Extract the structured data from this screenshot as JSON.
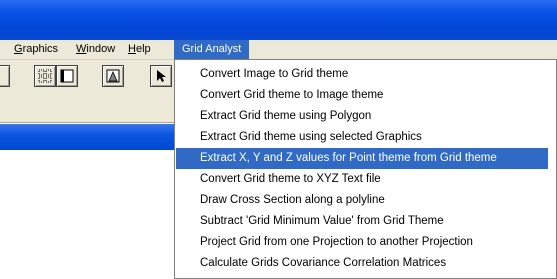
{
  "menubar": {
    "items": [
      {
        "label": "Graphics",
        "mnemonic": "G"
      },
      {
        "label": "Window",
        "mnemonic": "W"
      },
      {
        "label": "Help",
        "mnemonic": "H"
      },
      {
        "label": "Grid Analyst",
        "active": true
      }
    ]
  },
  "toolbar": {
    "buttons": [
      "partial-button-icon",
      "select-grid-icon",
      "layout-icon",
      "histogram-icon",
      "pointer-icon"
    ]
  },
  "grid_analyst_menu": {
    "items": [
      "Convert Image to Grid theme",
      "Convert Grid theme to Image theme",
      "Extract Grid theme using Polygon",
      "Extract Grid theme using selected Graphics",
      "Extract X, Y and Z values for Point theme from Grid theme",
      "Convert Grid theme to XYZ Text file",
      "Draw Cross Section along a polyline",
      "Subtract 'Grid Minimum Value' from Grid Theme",
      "Project Grid from one Projection to another Projection",
      "Calculate Grids Covariance Correlation Matrices"
    ],
    "highlighted_index": 4
  },
  "colors": {
    "titlebar": "#0a52e8",
    "menubar_bg": "#ece9d8",
    "highlight": "#316ac5"
  }
}
